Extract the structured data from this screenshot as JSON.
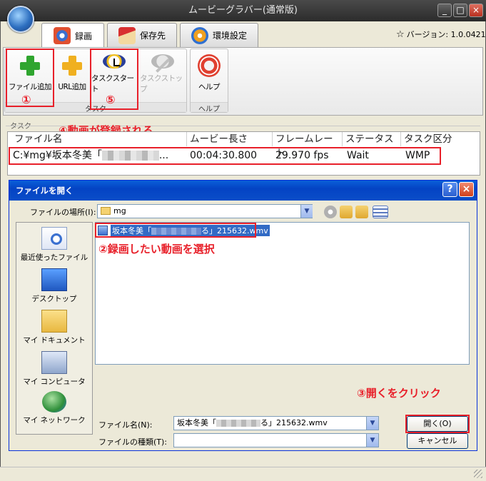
{
  "window": {
    "title": "ムービーグラバー(通常版)",
    "min": "_",
    "max": "□",
    "close": "×"
  },
  "tabs": [
    {
      "label": "録画",
      "icon": "film-reel-icon"
    },
    {
      "label": "保存先",
      "icon": "house-icon"
    },
    {
      "label": "環境設定",
      "icon": "gear-icon"
    }
  ],
  "version": {
    "text": "バージョン: 1.0.0421"
  },
  "ribbon": {
    "buttons": {
      "add_file": "ファイル追加",
      "add_url": "URL追加",
      "task_start": "タスクスタート",
      "task_stop": "タスクストップ",
      "help": "ヘルプ"
    },
    "groups": {
      "task": "タスク",
      "help": "ヘルプ"
    }
  },
  "task": {
    "section_label": "タスク",
    "columns": [
      "ファイル名",
      "ムービー長さ",
      "フレームレート",
      "ステータス",
      "タスク区分"
    ],
    "row": {
      "file": "C:¥mg¥坂本冬美「",
      "file_tail": "...",
      "length": "00:04:30.800",
      "framerate": "29.970 fps",
      "status": "Wait",
      "category": "WMP"
    }
  },
  "annotations": {
    "a1": "①",
    "a2": "②録画したい動画を選択",
    "a3": "③開くをクリック",
    "a4": "④動画が登録される",
    "a5": "⑤"
  },
  "dialog": {
    "title": "ファイルを開く",
    "lookin_label": "ファイルの場所(I):",
    "lookin_value": "mg",
    "places": [
      "最近使ったファイル",
      "デスクトップ",
      "マイ ドキュメント",
      "マイ コンピュータ",
      "マイ ネットワーク"
    ],
    "file_item_pre": "坂本冬美「",
    "file_item_post": "る」215632.wmv",
    "filename_label": "ファイル名(N):",
    "filename_pre": "坂本冬美「",
    "filename_post": "る」215632.wmv",
    "filetype_label": "ファイルの種類(T):",
    "open_button": "開く(O)",
    "cancel_button": "キャンセル",
    "help_btn": "?",
    "close_btn": "×"
  },
  "colors": {
    "annotation": "#e8202a",
    "selection": "#316ac5",
    "xp_title": "#0a5fd8"
  }
}
